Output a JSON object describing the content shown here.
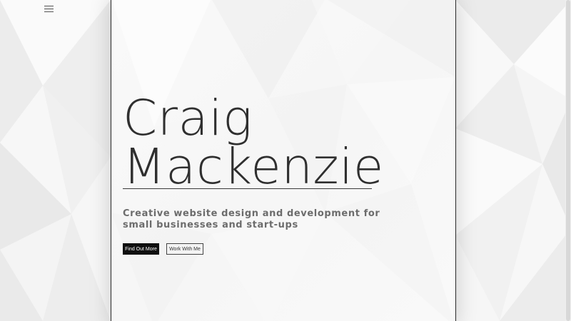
{
  "nav": {
    "menu_icon": "hamburger-menu-icon"
  },
  "hero": {
    "title_line1": "Craig",
    "title_line2": "Mackenzie",
    "tagline": "Creative website design and development for small businesses and start-ups"
  },
  "buttons": {
    "find_out_more": "Find Out More",
    "work_with_me": "Work With Me"
  },
  "colors": {
    "background": "#f2f2f2",
    "text": "#2f2f2f",
    "primary_button": "#0f0f0f",
    "tagline": "#6c6c6c"
  }
}
